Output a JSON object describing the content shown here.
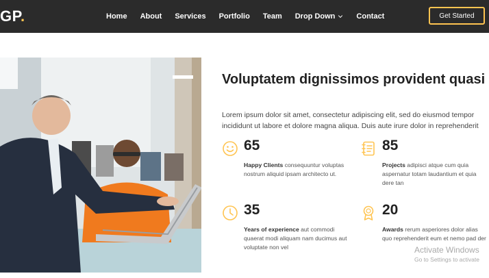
{
  "header": {
    "logo_text": "GP",
    "logo_dot": ".",
    "nav": [
      "Home",
      "About",
      "Services",
      "Portfolio",
      "Team",
      "Drop Down",
      "Contact"
    ],
    "cta_label": "Get Started",
    "accent": "#ffc451",
    "background": "#2b2b2b"
  },
  "about": {
    "title": "Voluptatem dignissimos provident quasi",
    "description": "Lorem ipsum dolor sit amet, consectetur adipiscing elit, sed do eiusmod tempor incididunt ut labore et dolore magna aliqua. Duis aute irure dolor in reprehenderit",
    "stats": [
      {
        "icon": "emoji-smile-icon",
        "number": "65",
        "label": "Happy Clients",
        "text": " consequuntur voluptas nostrum aliquid ipsam architecto ut."
      },
      {
        "icon": "journal-richtext-icon",
        "number": "85",
        "label": "Projects",
        "text": " adipisci atque cum quia aspernatur totam laudantium et quia dere tan"
      },
      {
        "icon": "clock-icon",
        "number": "35",
        "label": "Years of experience",
        "text": " aut commodi quaerat modi aliquam nam ducimus aut voluptate non vel"
      },
      {
        "icon": "award-icon",
        "number": "20",
        "label": "Awards",
        "text": " rerum asperiores dolor alias quo reprehenderit eum et nemo pad der"
      }
    ]
  },
  "watermark": {
    "line1": "Activate Windows",
    "line2": "Go to Settings to activate"
  }
}
